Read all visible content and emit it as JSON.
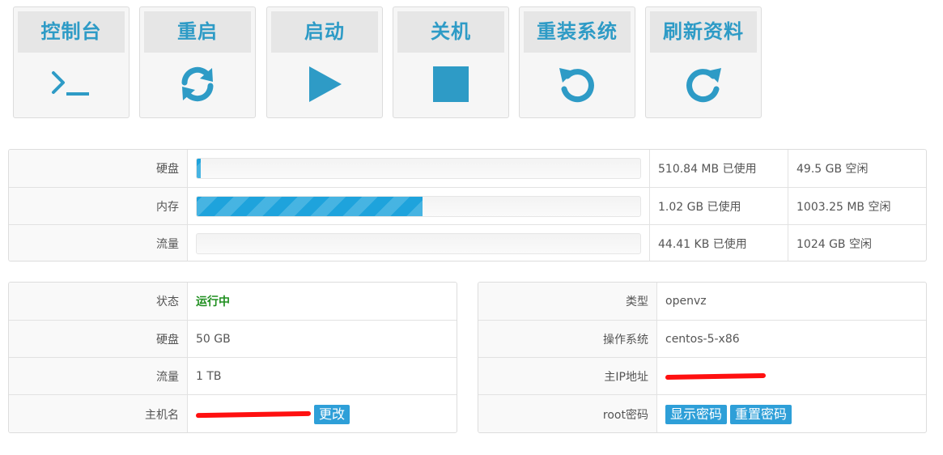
{
  "actions": [
    {
      "label": "控制台",
      "icon": "terminal-icon"
    },
    {
      "label": "重启",
      "icon": "refresh-icon"
    },
    {
      "label": "启动",
      "icon": "play-icon"
    },
    {
      "label": "关机",
      "icon": "stop-icon"
    },
    {
      "label": "重装系统",
      "icon": "undo-icon"
    },
    {
      "label": "刷新资料",
      "icon": "redo-icon"
    }
  ],
  "usage": [
    {
      "label": "硬盘",
      "used": "510.84 MB 已使用",
      "free": "49.5 GB 空闲",
      "percent": 1
    },
    {
      "label": "内存",
      "used": "1.02 GB 已使用",
      "free": "1003.25 MB 空闲",
      "percent": 51
    },
    {
      "label": "流量",
      "used": "44.41 KB 已使用",
      "free": "1024 GB 空闲",
      "percent": 0
    }
  ],
  "info_left": {
    "status_label": "状态",
    "status_value": "运行中",
    "disk_label": "硬盘",
    "disk_value": "50 GB",
    "traffic_label": "流量",
    "traffic_value": "1 TB",
    "hostname_label": "主机名",
    "change_button": "更改"
  },
  "info_right": {
    "type_label": "类型",
    "type_value": "openvz",
    "os_label": "操作系统",
    "os_value": "centos-5-x86",
    "ip_label": "主IP地址",
    "root_label": "root密码",
    "show_password_button": "显示密码",
    "reset_password_button": "重置密码"
  },
  "colors": {
    "accent": "#2e9bc6",
    "bar": "#1ea3dc",
    "running": "#1f8f1f",
    "redaction": "#ff1010"
  }
}
